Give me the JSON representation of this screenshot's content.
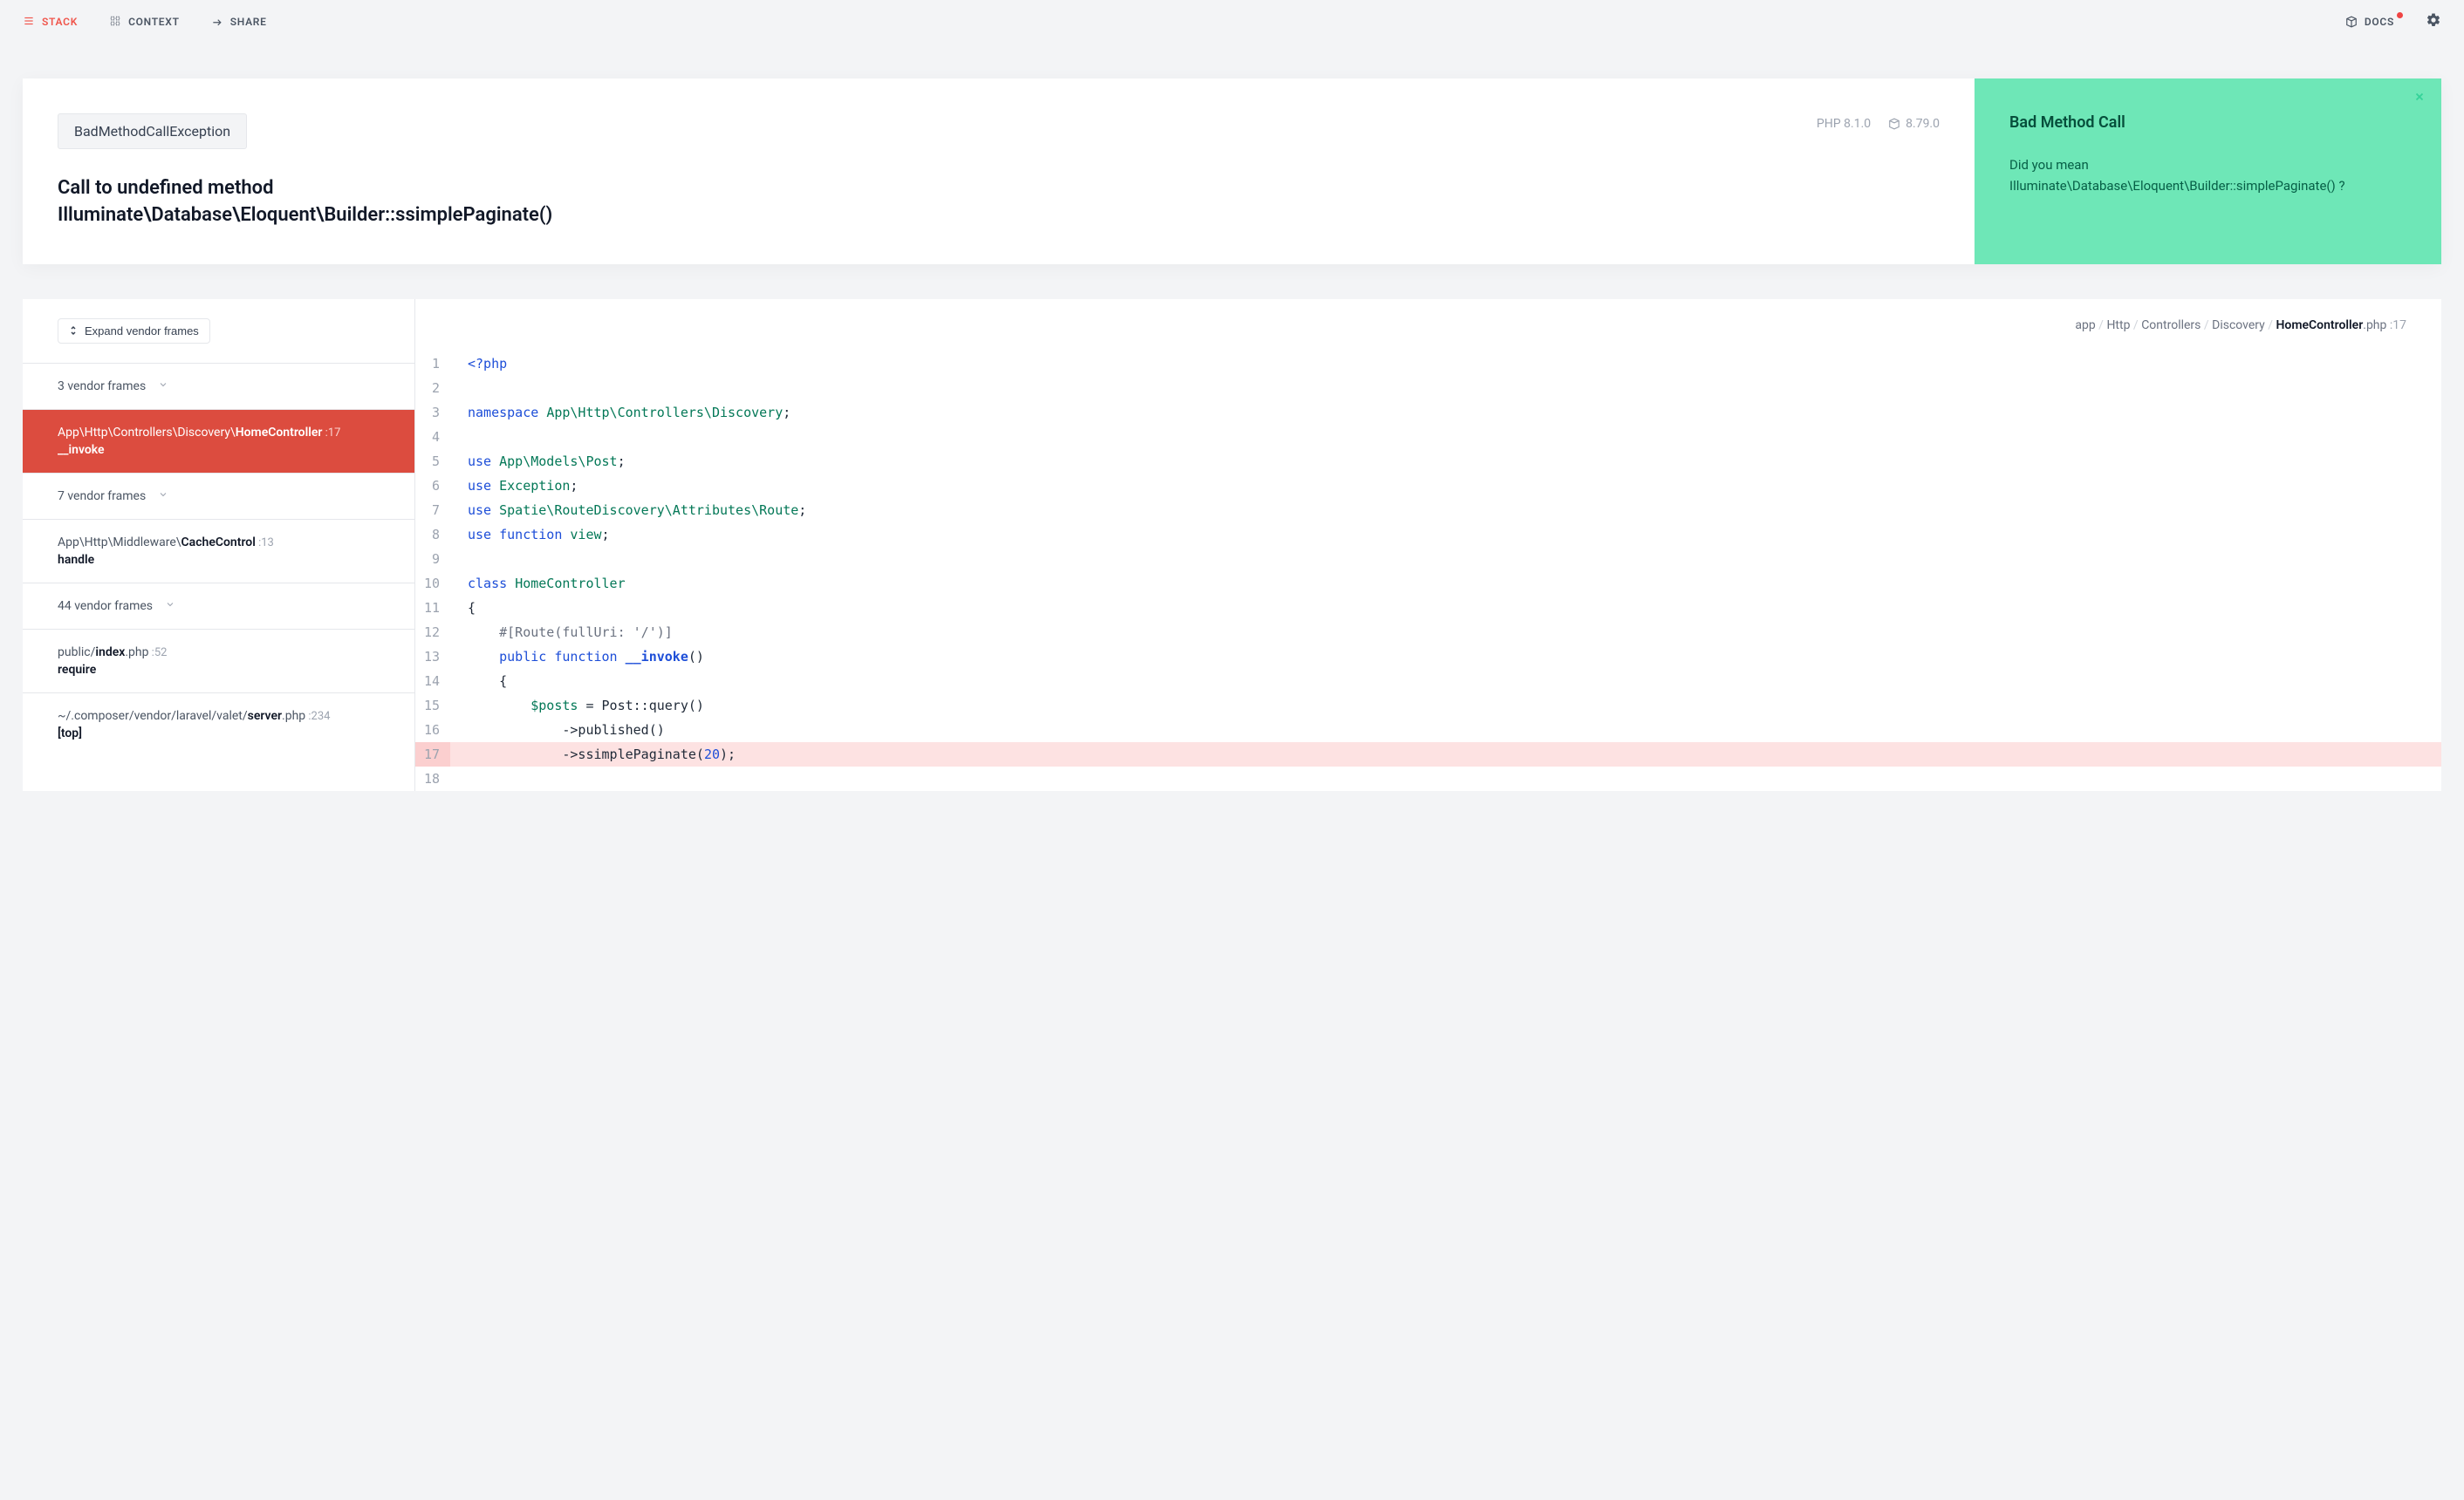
{
  "nav": {
    "tabs": [
      {
        "id": "stack",
        "label": "STACK",
        "active": true
      },
      {
        "id": "context",
        "label": "CONTEXT",
        "active": false
      },
      {
        "id": "share",
        "label": "SHARE",
        "active": false
      }
    ],
    "docs_label": "DOCS"
  },
  "hero": {
    "exception_class": "BadMethodCallException",
    "php_version": "PHP 8.1.0",
    "laravel_version": "8.79.0",
    "title_line1": "Call to undefined method",
    "title_line2": "Illuminate\\Database\\Eloquent\\Builder::ssimplePaginate()",
    "hint_title": "Bad Method Call",
    "hint_line1": "Did you mean",
    "hint_line2": "Illuminate\\Database\\Eloquent\\Builder::simplePaginate() ?"
  },
  "stack": {
    "expand_label": "Expand vendor frames",
    "frames": [
      {
        "type": "group",
        "label": "3 vendor frames"
      },
      {
        "type": "frame",
        "active": true,
        "loc_prefix": "App\\Http\\Controllers\\Discovery\\",
        "loc_strong": "HomeController",
        "line": "17",
        "fn": "__invoke"
      },
      {
        "type": "group",
        "label": "7 vendor frames"
      },
      {
        "type": "frame",
        "loc_prefix": "App\\Http\\Middleware\\",
        "loc_strong": "CacheControl",
        "line": "13",
        "fn": "handle"
      },
      {
        "type": "group",
        "label": "44 vendor frames"
      },
      {
        "type": "frame",
        "loc_prefix": "public/",
        "loc_strong": "index",
        "loc_suffix": ".php",
        "line": "52",
        "fn": "require"
      },
      {
        "type": "frame",
        "loc_prefix": "~/.composer/vendor/laravel/valet/",
        "loc_strong": "server",
        "loc_suffix": ".php",
        "line": "234",
        "fn": "[top]"
      }
    ]
  },
  "breadcrumb": {
    "parts": [
      "app",
      "Http",
      "Controllers",
      "Discovery"
    ],
    "file_strong": "HomeController",
    "file_suffix": ".php",
    "line": "17"
  },
  "code": {
    "start_line": 1,
    "highlight_line": 17,
    "lines": [
      {
        "n": 1,
        "html": "<span class='k'>&lt;?php</span>"
      },
      {
        "n": 2,
        "html": ""
      },
      {
        "n": 3,
        "html": "<span class='k'>namespace</span> <span class='s'>App\\Http\\Controllers\\Discovery</span>;"
      },
      {
        "n": 4,
        "html": ""
      },
      {
        "n": 5,
        "html": "<span class='k'>use</span> <span class='s'>App\\Models\\Post</span>;"
      },
      {
        "n": 6,
        "html": "<span class='k'>use</span> <span class='s'>Exception</span>;"
      },
      {
        "n": 7,
        "html": "<span class='k'>use</span> <span class='s'>Spatie\\RouteDiscovery\\Attributes\\Route</span>;"
      },
      {
        "n": 8,
        "html": "<span class='k'>use</span> <span class='k'>function</span> <span class='s'>view</span>;"
      },
      {
        "n": 9,
        "html": ""
      },
      {
        "n": 10,
        "html": "<span class='k'>class</span> <span class='s'>HomeController</span>"
      },
      {
        "n": 11,
        "html": "{"
      },
      {
        "n": 12,
        "html": "    <span class='cmt'>#[Route(fullUri: '/')]</span>"
      },
      {
        "n": 13,
        "html": "    <span class='k'>public</span> <span class='k'>function</span> <span class='k fnname'>__invoke</span>()"
      },
      {
        "n": 14,
        "html": "    {"
      },
      {
        "n": 15,
        "html": "        <span class='var'>$posts</span> = Post::query()"
      },
      {
        "n": 16,
        "html": "            -&gt;published()"
      },
      {
        "n": 17,
        "html": "            -&gt;ssimplePaginate(<span class='num'>20</span>);"
      },
      {
        "n": 18,
        "html": ""
      }
    ]
  }
}
